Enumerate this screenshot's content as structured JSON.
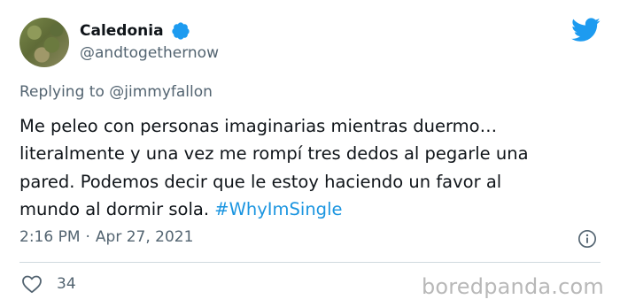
{
  "tweet": {
    "display_name": "Caledonia",
    "handle": "@andtogethernow",
    "replying_label": "Replying to",
    "replying_to": "@jimmyfallon",
    "text_lines": [
      "Me peleo con personas imaginarias mientras duermo…",
      "literalmente y una vez me rompí tres dedos al pegarle una",
      "pared. Podemos decir que le estoy haciendo un favor al",
      "mundo al dormir sola. "
    ],
    "hashtag": "#WhyImSingle",
    "time": "2:16 PM",
    "separator": "·",
    "date": "Apr 27, 2021",
    "likes": "34"
  },
  "icons": {
    "verified": "verified-badge-icon",
    "brand": "twitter-bird-icon",
    "info": "info-icon",
    "like": "heart-icon"
  },
  "watermark": "boredpanda.com",
  "colors": {
    "verified": "#1d9bf0",
    "twitter_blue": "#1d9bf0",
    "hashtag": "#1b95e0",
    "secondary_text": "#536471",
    "primary_text": "#0f1419"
  }
}
